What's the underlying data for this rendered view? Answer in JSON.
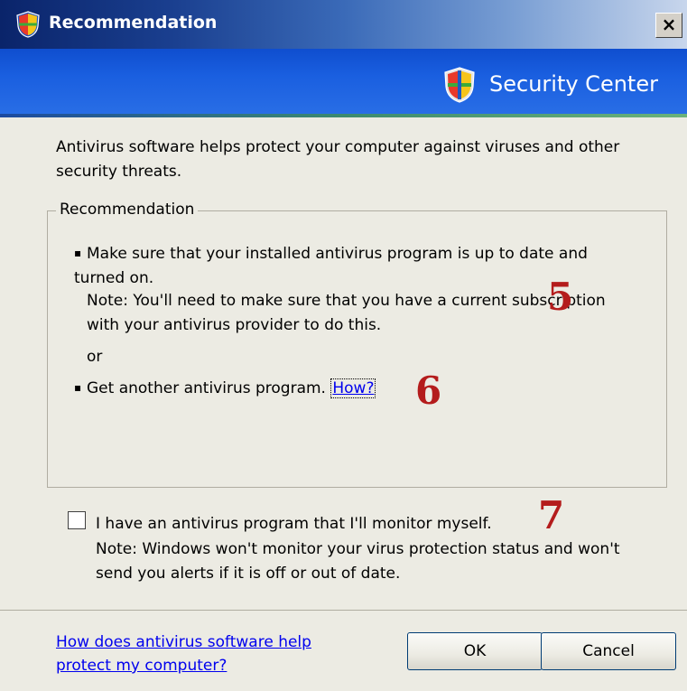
{
  "window": {
    "title": "Recommendation",
    "close_label": "×"
  },
  "banner": {
    "title": "Security Center"
  },
  "intro": "Antivirus software helps protect your computer against viruses and other security threats.",
  "recommendation": {
    "group_label": "Recommendation",
    "item1": "Make sure that your installed antivirus program is up to date and turned on.",
    "item1_note": "Note: You'll need to make sure that you have a current subscription with your antivirus provider to do this.",
    "or_text": "or",
    "item2": "Get another antivirus program.",
    "how_link": "How?"
  },
  "self_monitor": {
    "checked": false,
    "label": "I have an antivirus program that I'll monitor myself.",
    "note": "Note: Windows won't monitor your virus protection status and won't send you alerts if it is off or out of date."
  },
  "footer": {
    "help_link": "How does antivirus software help protect my computer?",
    "ok_label": "OK",
    "cancel_label": "Cancel"
  },
  "annotations": {
    "five": "5",
    "six": "6",
    "seven": "7"
  },
  "colors": {
    "annotation": "#b41c1c",
    "link": "#0000ee",
    "titlebar_start": "#0a246a",
    "banner": "#1a5fe0"
  },
  "icons": {
    "title_icon": "shield-icon",
    "banner_icon": "shield-icon",
    "close_icon": "close-icon"
  }
}
